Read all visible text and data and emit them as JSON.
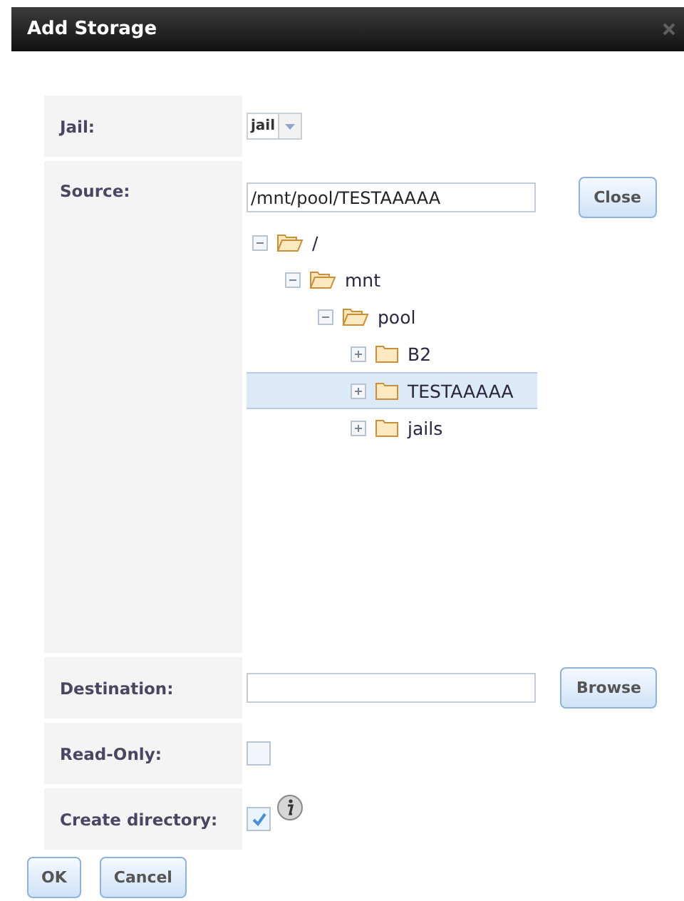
{
  "window": {
    "title": "Add Storage"
  },
  "jail": {
    "label": "Jail:",
    "value": "jail"
  },
  "source": {
    "label": "Source:",
    "value": "/mnt/pool/TESTAAAAA",
    "button": "Close",
    "tree": [
      {
        "name": "/",
        "expanded": true,
        "selected": false,
        "children": [
          {
            "name": "mnt",
            "expanded": true,
            "selected": false,
            "children": [
              {
                "name": "pool",
                "expanded": true,
                "selected": false,
                "children": [
                  {
                    "name": "B2",
                    "expanded": false,
                    "selected": false
                  },
                  {
                    "name": "TESTAAAAA",
                    "expanded": false,
                    "selected": true
                  },
                  {
                    "name": "jails",
                    "expanded": false,
                    "selected": false
                  }
                ]
              }
            ]
          }
        ]
      }
    ]
  },
  "destination": {
    "label": "Destination:",
    "button": "Browse"
  },
  "read_only": {
    "label": "Read-Only:",
    "checked": false
  },
  "create_directory": {
    "label": "Create directory:",
    "checked": true
  },
  "buttons": [
    "OK",
    "Cancel"
  ]
}
